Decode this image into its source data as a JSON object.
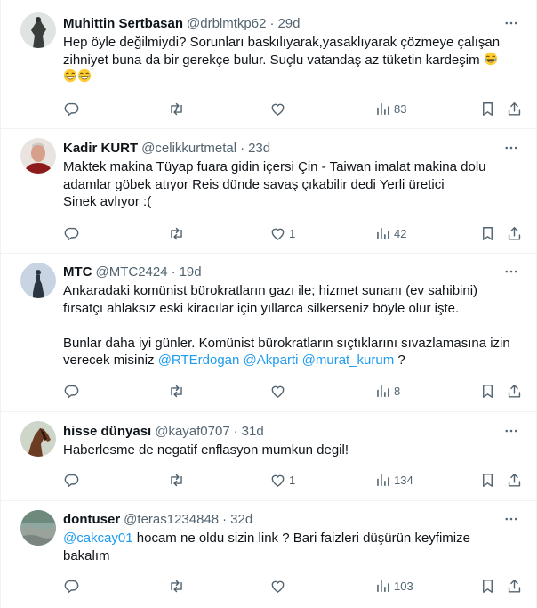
{
  "tweets": [
    {
      "name": "Muhittin Sertbasan",
      "handle": "@drblmtkp62",
      "time": "29d",
      "lines": [
        "Hep öyle değilmiydi? Sorunları baskılıyarak,yasaklıyarak çözmeye çalışan",
        "zihniyet buna da bir gerekçe bulur. Suçlu vatandaş az tüketin kardeşim"
      ],
      "replies": "",
      "retweets": "",
      "likes": "",
      "views": "83"
    },
    {
      "name": "Kadir KURT",
      "handle": "@celikkurtmetal",
      "time": "23d",
      "lines": [
        "Maktek makina Tüyap fuara gidin içersi Çin - Taiwan imalat makina dolu",
        "adamlar göbek atıyor Reis dünde savaş çıkabilir dedi Yerli üretici",
        "Sinek avlıyor :("
      ],
      "replies": "",
      "retweets": "",
      "likes": "1",
      "views": "42"
    },
    {
      "name": "MTC",
      "handle": "@MTC2424",
      "time": "19d",
      "lines": [
        "Ankaradaki komünist bürokratların gazı ile; hizmet sunanı (ev sahibini)",
        "fırsatçı ahlaksız eski kiracılar için yıllarca silkerseniz böyle olur işte.",
        "Bunlar daha iyi günler. Komünist bürokratların sıçtıklarını sıvazlamasına izin",
        "verecek misiniz"
      ],
      "mentions": [
        "@RTErdogan",
        "@Akparti",
        "@murat_kurum"
      ],
      "tail": "?",
      "replies": "",
      "retweets": "",
      "likes": "",
      "views": "8"
    },
    {
      "name": "hisse dünyası",
      "handle": "@kayaf0707",
      "time": "31d",
      "lines": [
        "Haberlesme de negatif enflasyon mumkun degil!"
      ],
      "replies": "",
      "retweets": "",
      "likes": "1",
      "views": "134"
    },
    {
      "name": "dontuser",
      "handle": "@teras1234848",
      "time": "32d",
      "mention": "@cakcay01",
      "lines": [
        "hocam ne oldu sizin link ? Bari faizleri düşürün keyfimize",
        "bakalım"
      ],
      "replies": "",
      "retweets": "",
      "likes": "",
      "views": "103"
    }
  ],
  "dot": "·",
  "icons": [
    "reply-icon",
    "retweet-icon",
    "like-icon",
    "views-icon",
    "bookmark-icon",
    "share-icon",
    "more-icon",
    "laughing-emoji"
  ],
  "colors": {
    "link": "#1d9bf0",
    "muted": "#536471",
    "text": "#0f1419",
    "border": "#eff3f4"
  }
}
